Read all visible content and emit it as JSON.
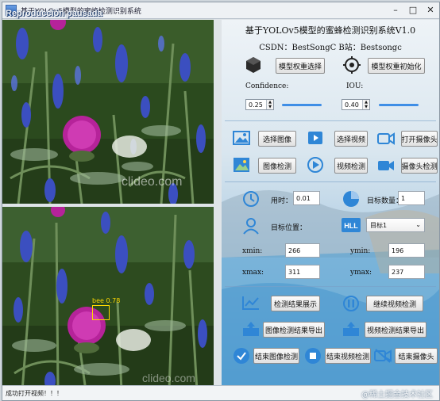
{
  "window": {
    "title": "基于YOLOv5模型的蜜蜂检测识别系统",
    "title_overlay": "Reproducción pausada"
  },
  "views": {
    "top": {
      "watermark": "clideo.com"
    },
    "bottom": {
      "watermark": "clideo.com",
      "detection_label": "bee 0.78"
    }
  },
  "panel": {
    "title": "基于YOLOv5模型的蜜蜂检测识别系统V1.0",
    "info": "CSDN：BestSongC   B站：Bestsongc",
    "model_select_label": "模型权重选择",
    "model_init_label": "模型权重初始化",
    "confidence_label": "Confidence:",
    "confidence_value": "0.25",
    "confidence_level": 0.25,
    "iou_label": "IOU:",
    "iou_value": "0.40",
    "iou_level": 0.4,
    "select_image_label": "选择图像",
    "select_video_label": "选择视频",
    "open_camera_label": "打开摄像头",
    "detect_image_label": "图像检测",
    "detect_video_label": "视频检测",
    "detect_camera_label": "摄像头检测",
    "time_label": "用时：",
    "time_value": "0.01",
    "target_count_label": "目标数量：",
    "target_count_value": "1",
    "target_position_label": "目标位置：",
    "target_select_value": "目标1",
    "xmin_label": "xmin:",
    "xmin_value": "266",
    "ymin_label": "ymin:",
    "ymin_value": "196",
    "xmax_label": "xmax:",
    "xmax_value": "311",
    "ymax_label": "ymax:",
    "ymax_value": "237",
    "show_results_label": "检测结果展示",
    "continue_video_label": "继续视频检测",
    "export_image_label": "图像检测结果导出",
    "export_video_label": "视频检测结果导出",
    "end_image_label": "结束图像检测",
    "end_video_label": "结束视频检测",
    "end_camera_label": "结束摄像头"
  },
  "status": {
    "text": "成功打开视频！！！",
    "watermark": "@稀土掘金技术社区"
  },
  "colors": {
    "accent": "#2f86d6",
    "slider": "#3f8ee6",
    "detection_box": "#ffd900"
  }
}
